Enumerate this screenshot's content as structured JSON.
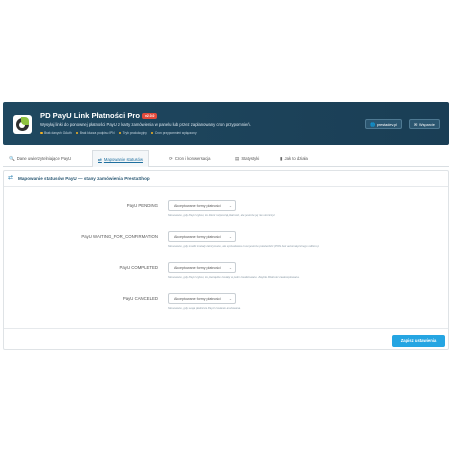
{
  "header": {
    "title": "PD PayU Link Płatności Pro",
    "version": "v2.0.0",
    "subtitle": "Wysyłaj linki do ponownej płatności PayU z karty zamówienia w panelu lub przez zaplanowany cron przypomnień.",
    "features": [
      "Brak danych OAuth",
      "Brak klucza podpisu IPN",
      "Tryb produkcyjny",
      "Cron przypomnień wyłączony"
    ],
    "feature_color": "#f5b324",
    "buttons": [
      {
        "label": "prestadev.pl",
        "icon": "globe-icon"
      },
      {
        "label": "Wsparcie",
        "icon": "envelope-icon"
      }
    ],
    "background": "#1f4860"
  },
  "tabs": [
    {
      "label": "Dane uwierzytelniające PayU",
      "icon": "key-icon",
      "active": false
    },
    {
      "label": "Mapowanie statusów",
      "icon": "exchange-icon",
      "active": true
    },
    {
      "label": "Cron i konwersacja",
      "icon": "refresh-icon",
      "active": false
    },
    {
      "label": "Statystyki",
      "icon": "bar-chart-icon",
      "active": false
    },
    {
      "label": "Jak to działa",
      "icon": "book-icon",
      "active": false
    }
  ],
  "panel": {
    "title": "Mapowanie statusów PayU — stany zamówienia PrestaShop",
    "icon": "exchange-icon",
    "rows": [
      {
        "label": "PayU PENDING",
        "value": "Akceptowane formy płatności",
        "help": "Stosowane, gdy PayU zgłosi, że klient rozpoczął płatność, ale jeszcze jej nie ukończył."
      },
      {
        "label": "PayU WAITING_FOR_CONFIRMATION",
        "value": "Akceptowane formy płatności",
        "help": "Stosowane, gdy środki zostały zatrzymane, ale sprzedawca musi jeszcze potwierdzić (POS bez automatycznego odbioru)."
      },
      {
        "label": "PayU COMPLETED",
        "value": "Akceptowane formy płatności",
        "help": "Stosowane, gdy PayU zgłosi, że pieniądze zostały w pełni zrealizowane. Zwykle Płatność zaakceptowana."
      },
      {
        "label": "PayU CANCELED",
        "value": "Akceptowane formy płatności",
        "help": "Stosowane, gdy sesja płatnicza PayU zostanie anulowana."
      }
    ]
  },
  "save_button": "Zapisz ustawienia",
  "accent": "#25a5e2"
}
